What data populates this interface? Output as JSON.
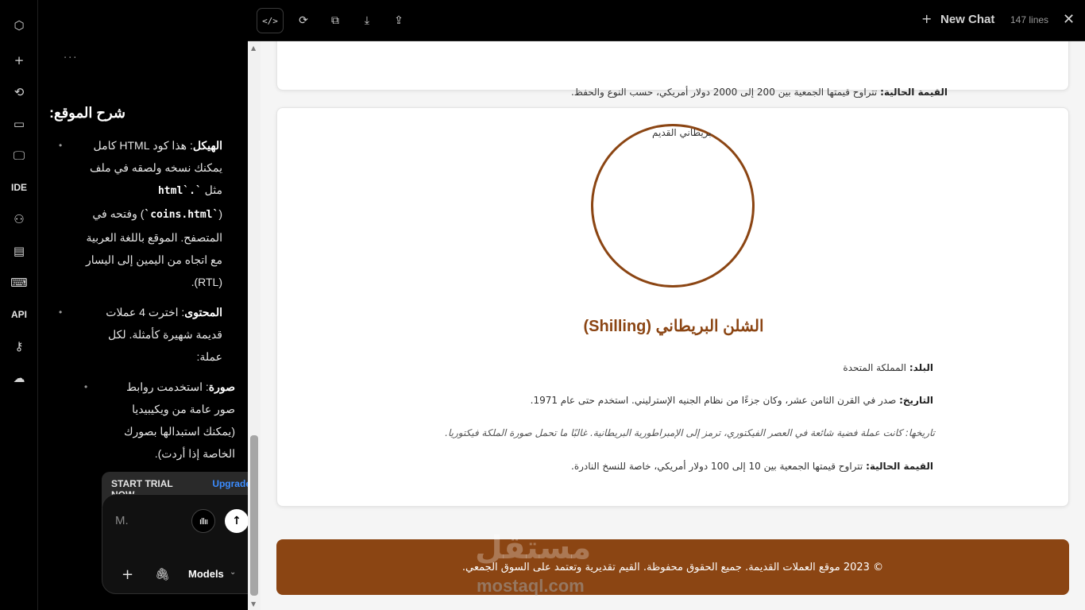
{
  "rail": {
    "items": [
      {
        "icon": "hexagon-logo-icon",
        "glyph": "⬡"
      },
      {
        "icon": "plus-icon",
        "glyph": "+"
      },
      {
        "icon": "history-icon",
        "glyph": "⟲"
      },
      {
        "icon": "browser-icon",
        "glyph": "▭"
      },
      {
        "icon": "monitor-icon",
        "glyph": "🖵"
      },
      {
        "icon": "ide-icon",
        "label": "IDE"
      },
      {
        "icon": "users-icon",
        "glyph": "⚇"
      },
      {
        "icon": "document-icon",
        "glyph": "▤"
      },
      {
        "icon": "keyboard-icon",
        "glyph": "⌨"
      },
      {
        "icon": "api-icon",
        "label": "API"
      },
      {
        "icon": "key-icon",
        "glyph": "⚷"
      },
      {
        "icon": "cloud-icon",
        "glyph": "☁"
      }
    ]
  },
  "chat": {
    "dots": "···",
    "heading": "شرح الموقع:",
    "items": [
      {
        "bold": "الهيكل",
        "text_a": ": هذا كود HTML كامل يمكنك نسخه ولصقه في ملف مثل ",
        "code_a": "`.html`",
        "text_b": " (",
        "code_b": "`coins.html`",
        "text_c": ") وفتحه في المتصفح. الموقع باللغة العربية مع اتجاه من اليمين إلى اليسار (RTL)."
      },
      {
        "bold": "المحتوى",
        "text_a": ": اخترت 4 عملات قديمة شهيرة كأمثلة. لكل عملة:"
      }
    ],
    "subitems": [
      {
        "bold": "صورة",
        "text_a": ": استخدمت روابط صور عامة من ويكيبيديا (يمكنك استبدالها بصورك الخاصة إذا أردت)."
      }
    ],
    "trial_label": "START TRIAL NOW",
    "upgrade_label": "Upgrade",
    "composer": {
      "placeholder": "M.",
      "mic_glyph": "ıllıı",
      "send_glyph": "↑",
      "plus_glyph": "+",
      "clip_glyph": "🖇",
      "models_label": "Models",
      "chevron_glyph": "⌄"
    }
  },
  "toolbar": {
    "code_glyph": "</>",
    "refresh_glyph": "⟳",
    "copy_glyph": "⧉",
    "download_glyph": "⤓",
    "share_glyph": "⇪",
    "new_chat_plus": "+",
    "new_chat_label": "New Chat",
    "lines_label": "147 lines",
    "close_glyph": "✕"
  },
  "preview": {
    "top_card": {
      "value_label": "القيمة الحالية:",
      "value_text": " تتراوح قيمتها الجمعية بين 200 إلى 2000 دولار أمريكي، حسب النوع والحفظ."
    },
    "coin": {
      "image_alt": "بريطاني القديم",
      "title": "الشلن البريطاني (Shilling)",
      "country_label": "البلد:",
      "country_text": " المملكة المتحدة",
      "date_label": "التاريخ:",
      "date_text": " صدر في القرن الثامن عشر، وكان جزءًا من نظام الجنيه الإسترليني. استخدم حتى عام 1971.",
      "history_text": "تاريخها: كانت عملة فضية شائعة في العصر الفيكتوري، ترمز إلى الإمبراطورية البريطانية. غالبًا ما تحمل صورة الملكة فيكتوريا.",
      "value_label": "القيمة الحالية:",
      "value_text": " تتراوح قيمتها الجمعية بين 10 إلى 100 دولار أمريكي، خاصة للنسخ النادرة."
    },
    "footer_text": "© 2023 موقع العملات القديمة. جميع الحقوق محفوظة. القيم تقديرية وتعتمد على السوق الجمعي.",
    "watermark_ar": "مستقل",
    "watermark_en": "mostaql.com"
  },
  "colors": {
    "accent_brown": "#8b4513",
    "upgrade_blue": "#3b8cff"
  }
}
